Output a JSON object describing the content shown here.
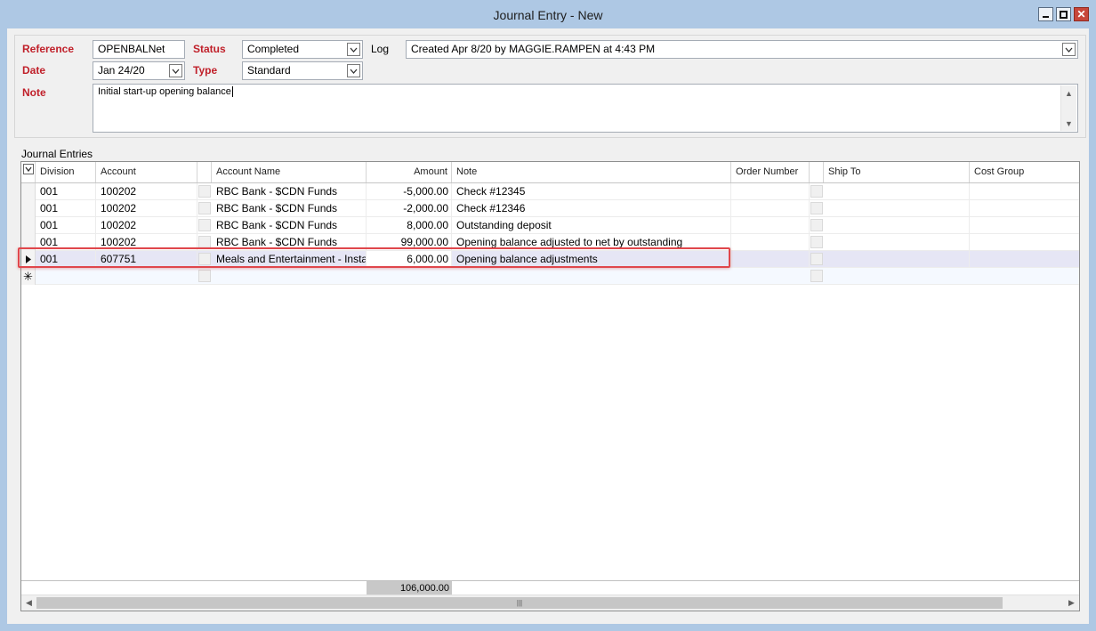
{
  "window": {
    "title": "Journal Entry - New"
  },
  "header": {
    "reference_label": "Reference",
    "reference_value": "OPENBALNet",
    "status_label": "Status",
    "status_value": "Completed",
    "log_label": "Log",
    "log_value": "Created Apr 8/20 by MAGGIE.RAMPEN at 4:43 PM",
    "date_label": "Date",
    "date_value": "Jan 24/20",
    "type_label": "Type",
    "type_value": "Standard",
    "note_label": "Note",
    "note_value": "Initial start-up opening balance"
  },
  "grid": {
    "group_label": "Journal Entries",
    "columns": [
      "Division",
      "Account",
      "Account Name",
      "Amount",
      "Note",
      "Order Number",
      "Ship To",
      "Cost Group"
    ],
    "rows": [
      {
        "division": "001",
        "account": "100202",
        "account_name": "RBC Bank -  $CDN Funds",
        "amount": "-5,000.00",
        "note": "Check #12345"
      },
      {
        "division": "001",
        "account": "100202",
        "account_name": "RBC Bank -  $CDN Funds",
        "amount": "-2,000.00",
        "note": "Check #12346"
      },
      {
        "division": "001",
        "account": "100202",
        "account_name": "RBC Bank -  $CDN Funds",
        "amount": "8,000.00",
        "note": "Outstanding deposit"
      },
      {
        "division": "001",
        "account": "100202",
        "account_name": "RBC Bank -  $CDN Funds",
        "amount": "99,000.00",
        "note": "Opening balance adjusted to net by outstanding"
      },
      {
        "division": "001",
        "account": "607751",
        "account_name": "Meals and Entertainment - Insta...",
        "amount": "6,000.00",
        "note": "Opening balance adjustments"
      }
    ],
    "total_amount": "106,000.00"
  },
  "icons": {
    "dropdown": "chevron-down-icon",
    "row_current": "row-pointer-icon",
    "row_new": "new-row-star-icon"
  },
  "colors": {
    "required_label": "#c0202a",
    "highlight": "#e0474c",
    "selected_row": "#e6e6f5"
  }
}
